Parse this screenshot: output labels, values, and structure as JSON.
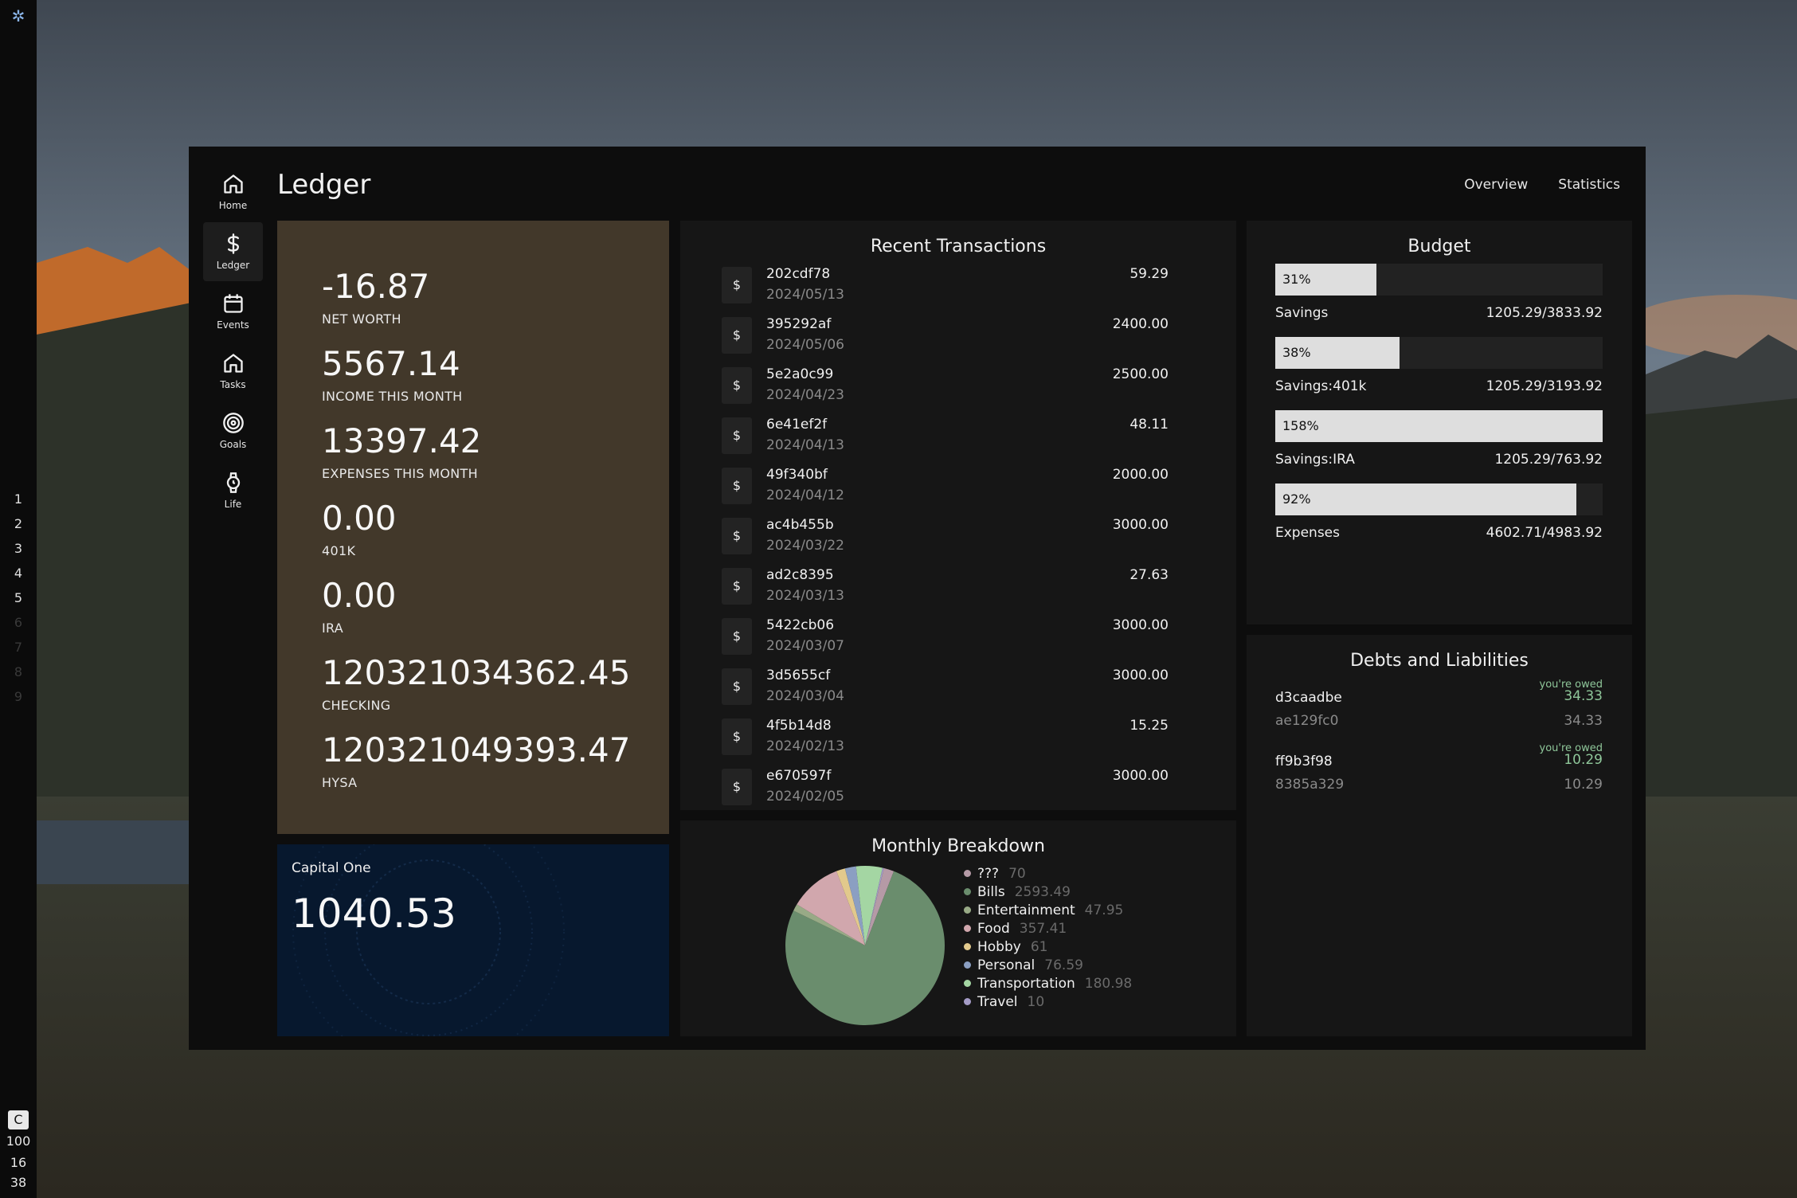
{
  "system_bar": {
    "workspaces": [
      "1",
      "2",
      "3",
      "4",
      "5",
      "6",
      "7",
      "8",
      "9"
    ],
    "bottom": {
      "indicator": "C",
      "value1": "100",
      "value2": "16",
      "value3": "38"
    }
  },
  "app": {
    "title": "Ledger",
    "top_nav": [
      "Overview",
      "Statistics"
    ],
    "nav": [
      {
        "label": "Home",
        "icon": "home-icon"
      },
      {
        "label": "Ledger",
        "icon": "dollar-icon"
      },
      {
        "label": "Events",
        "icon": "calendar-icon"
      },
      {
        "label": "Tasks",
        "icon": "home-icon"
      },
      {
        "label": "Goals",
        "icon": "target-icon"
      },
      {
        "label": "Life",
        "icon": "watch-icon"
      }
    ]
  },
  "summary": [
    {
      "value": "-16.87",
      "label": "NET WORTH"
    },
    {
      "value": "5567.14",
      "label": "INCOME THIS MONTH"
    },
    {
      "value": "13397.42",
      "label": "EXPENSES THIS MONTH"
    },
    {
      "value": "0.00",
      "label": "401K"
    },
    {
      "value": "0.00",
      "label": "IRA"
    },
    {
      "value": "120321034362.45",
      "label": "CHECKING"
    },
    {
      "value": "120321049393.47",
      "label": "HYSA"
    }
  ],
  "card": {
    "name": "Capital One",
    "balance": "1040.53"
  },
  "transactions": {
    "title": "Recent Transactions",
    "icon_symbol": "$",
    "rows": [
      {
        "id": "202cdf78",
        "date": "2024/05/13",
        "amount": "59.29"
      },
      {
        "id": "395292af",
        "date": "2024/05/06",
        "amount": "2400.00"
      },
      {
        "id": "5e2a0c99",
        "date": "2024/04/23",
        "amount": "2500.00"
      },
      {
        "id": "6e41ef2f",
        "date": "2024/04/13",
        "amount": "48.11"
      },
      {
        "id": "49f340bf",
        "date": "2024/04/12",
        "amount": "2000.00"
      },
      {
        "id": "ac4b455b",
        "date": "2024/03/22",
        "amount": "3000.00"
      },
      {
        "id": "ad2c8395",
        "date": "2024/03/13",
        "amount": "27.63"
      },
      {
        "id": "5422cb06",
        "date": "2024/03/07",
        "amount": "3000.00"
      },
      {
        "id": "3d5655cf",
        "date": "2024/03/04",
        "amount": "3000.00"
      },
      {
        "id": "4f5b14d8",
        "date": "2024/02/13",
        "amount": "15.25"
      },
      {
        "id": "e670597f",
        "date": "2024/02/05",
        "amount": "3000.00"
      }
    ]
  },
  "breakdown": {
    "title": "Monthly Breakdown",
    "items": [
      {
        "name": "???",
        "value": "70",
        "color": "#b59aa6"
      },
      {
        "name": "Bills",
        "value": "2593.49",
        "color": "#6a8d6d"
      },
      {
        "name": "Entertainment",
        "value": "47.95",
        "color": "#98aa86"
      },
      {
        "name": "Food",
        "value": "357.41",
        "color": "#d1a7ad"
      },
      {
        "name": "Hobby",
        "value": "61",
        "color": "#e2c98c"
      },
      {
        "name": "Personal",
        "value": "76.59",
        "color": "#8b9fc2"
      },
      {
        "name": "Transportation",
        "value": "180.98",
        "color": "#a4d6a3"
      },
      {
        "name": "Travel",
        "value": "10",
        "color": "#a49bc6"
      }
    ]
  },
  "budget": {
    "title": "Budget",
    "items": [
      {
        "name": "Savings",
        "amount": "1205.29/3833.92",
        "percent": "31%",
        "fill": 0.31
      },
      {
        "name": "Savings:401k",
        "amount": "1205.29/3193.92",
        "percent": "38%",
        "fill": 0.38
      },
      {
        "name": "Savings:IRA",
        "amount": "1205.29/763.92",
        "percent": "158%",
        "fill": 1.0
      },
      {
        "name": "Expenses",
        "amount": "4602.71/4983.92",
        "percent": "92%",
        "fill": 0.92
      }
    ]
  },
  "debts": {
    "title": "Debts and Liabilities",
    "items": [
      {
        "status": "you're owed",
        "name": "d3caadbe",
        "sub": "ae129fc0",
        "amount": "34.33",
        "sub_amount": "34.33"
      },
      {
        "status": "you're owed",
        "name": "ff9b3f98",
        "sub": "8385a329",
        "amount": "10.29",
        "sub_amount": "10.29"
      }
    ]
  }
}
